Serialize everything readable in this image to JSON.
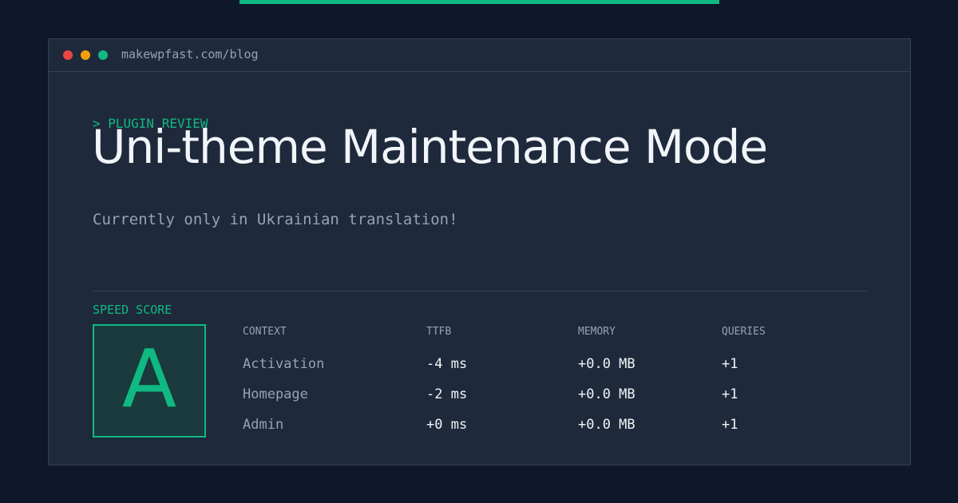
{
  "window": {
    "url": "makewpfast.com/blog"
  },
  "header": {
    "kicker": "> PLUGIN REVIEW",
    "title": "Uni-theme Maintenance Mode",
    "subtitle": "Currently only in Ukrainian translation!"
  },
  "score": {
    "label": "SPEED SCORE",
    "grade": "A"
  },
  "table": {
    "headers": [
      "CONTEXT",
      "TTFB",
      "MEMORY",
      "QUERIES"
    ],
    "rows": [
      [
        "Activation",
        "-4 ms",
        "+0.0 MB",
        "+1"
      ],
      [
        "Homepage",
        "-2 ms",
        "+0.0 MB",
        "+1"
      ],
      [
        "Admin",
        "+0 ms",
        "+0.0 MB",
        "+1"
      ]
    ]
  },
  "colors": {
    "accent": "#10b981",
    "background": "#0f172a",
    "panel": "#1e293b",
    "close": "#ef4444",
    "minimize": "#f59e0b",
    "maximize": "#10b981"
  }
}
